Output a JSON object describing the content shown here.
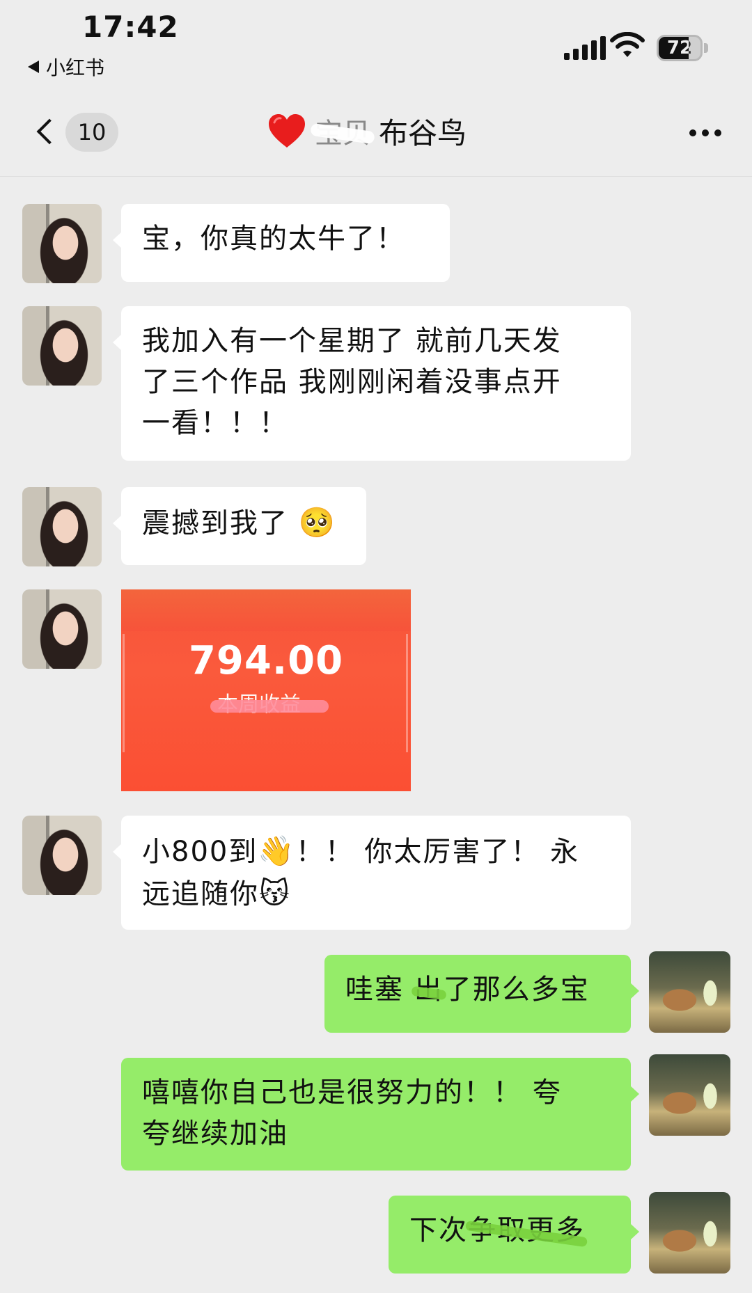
{
  "status_bar": {
    "time": "17:42",
    "back_app_label": "小红书",
    "battery_level": "72"
  },
  "nav": {
    "unread_count": "10",
    "title_redacted": "宝贝",
    "title_name": "布谷鸟",
    "heart_icon": "red-heart-icon",
    "more_icon": "more-dots-icon"
  },
  "messages": [
    {
      "side": "in",
      "text": "宝，你真的太牛了！"
    },
    {
      "side": "in",
      "text_a": "我加入有一个星期了 就前几天发",
      "text_b": "了三个作品 我刚刚闲着没事点开",
      "text_c": "一看！！！"
    },
    {
      "side": "in",
      "text": "震撼到我了",
      "emoji": "🥺"
    },
    {
      "side": "in",
      "type": "image",
      "amount": "794.00",
      "amount_label": "本周收益"
    },
    {
      "side": "in",
      "text_a": "小800到",
      "emoji_a": "👋",
      "text_b": "！！ 你太厉害了！ 永",
      "text_c": "远追随你",
      "emoji_c": "😽"
    },
    {
      "side": "out",
      "text_pre": "哇塞 ",
      "text_struck": "出",
      "text_post": "了那么多宝"
    },
    {
      "side": "out",
      "text_a": "嘻嘻你自己也是很努力的！！ 夸",
      "text_b": "夸继续加油"
    },
    {
      "side": "out",
      "text_pre": "下次",
      "text_struck": "争取更多"
    }
  ]
}
